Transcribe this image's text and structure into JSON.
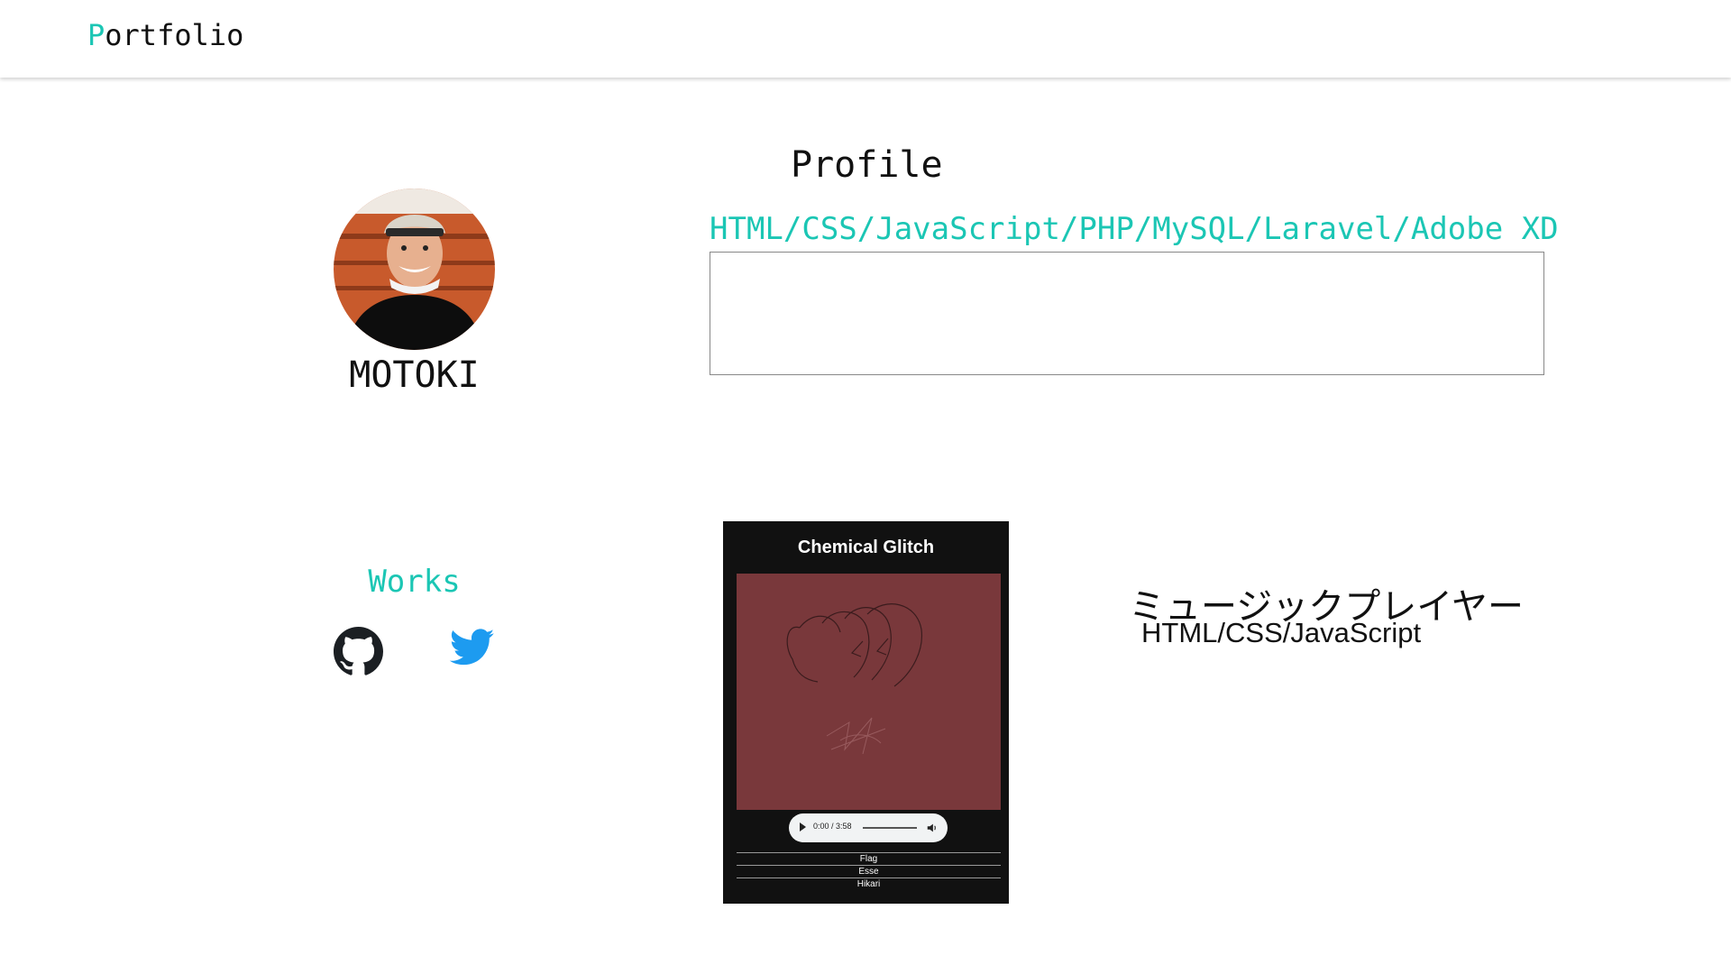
{
  "header": {
    "logo_initial": "P",
    "logo_rest": "ortfolio"
  },
  "profile": {
    "title": "Profile",
    "name": "MOTOKI",
    "skills": "HTML/CSS/JavaScript/PHP/MySQL/Laravel/Adobe  XD",
    "bio": "",
    "avatar_icon": "profile-photo"
  },
  "works": {
    "title": "Works",
    "links": [
      {
        "icon": "github-icon"
      },
      {
        "icon": "twitter-icon"
      }
    ],
    "items": [
      {
        "card_title": "Chemical Glitch",
        "audio_time": "0:00 / 3:58",
        "tracks": [
          "Flag",
          "Esse",
          "Hikari"
        ],
        "name": "ミュージックプレイヤー",
        "tech": "HTML/CSS/JavaScript"
      }
    ]
  },
  "colors": {
    "accent": "#1bc6b4",
    "cover": "#79383b",
    "twitter": "#1d9bf0"
  }
}
